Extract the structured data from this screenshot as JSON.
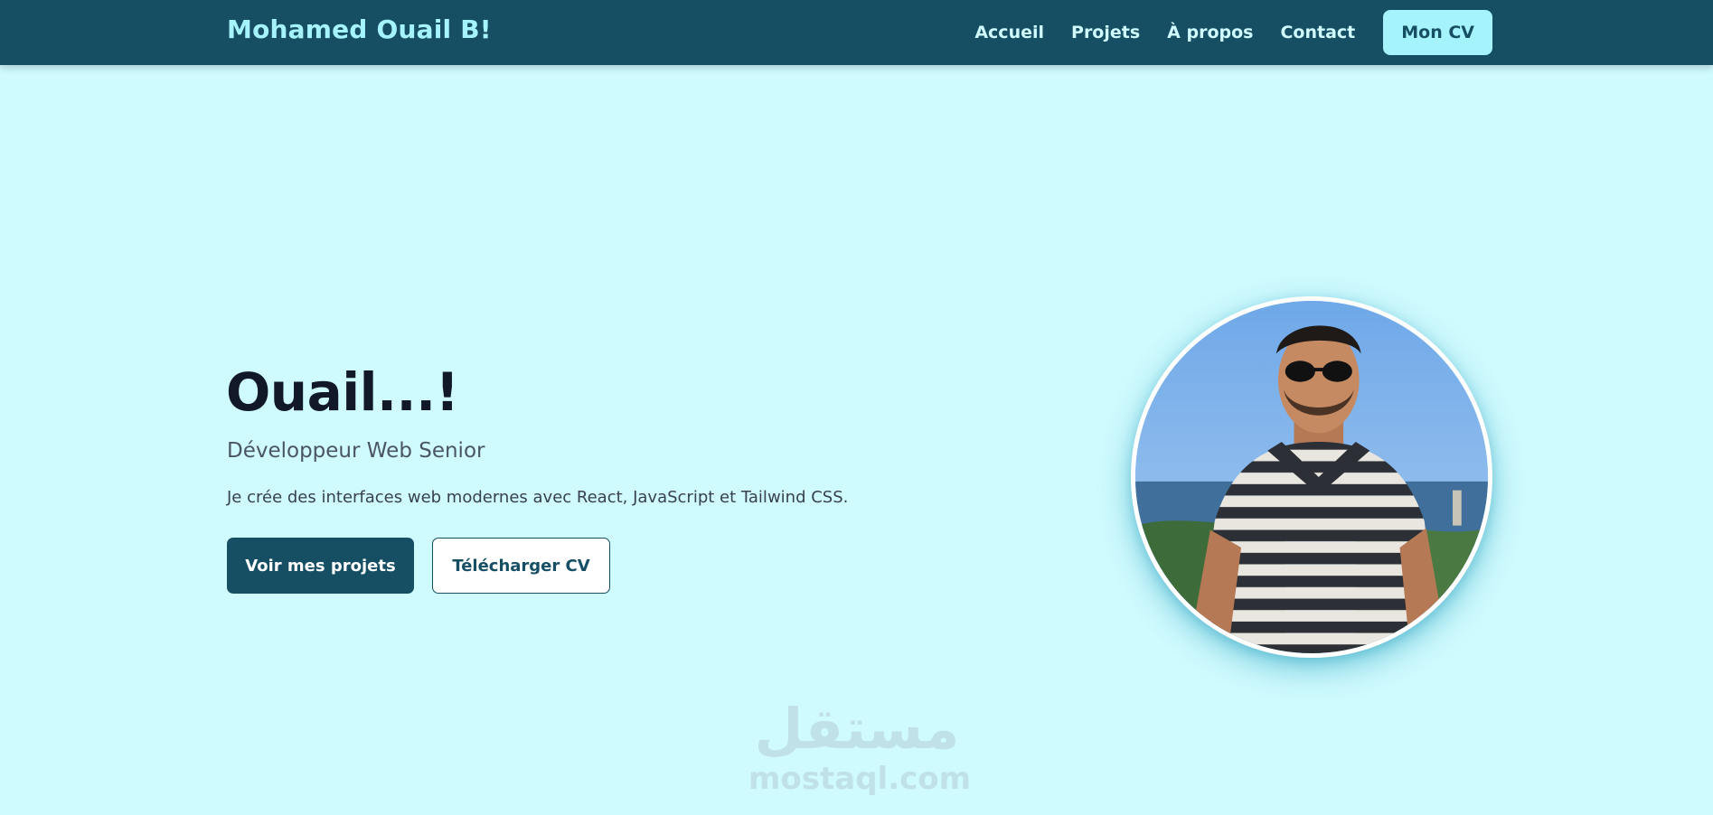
{
  "navbar": {
    "brand": "Mohamed Ouail B!",
    "links": [
      "Accueil",
      "Projets",
      "À propos",
      "Contact"
    ],
    "cv_button": "Mon CV"
  },
  "hero": {
    "title": "Ouail...!",
    "subtitle": "Développeur Web Senior",
    "description": "Je crée des interfaces web modernes avec React, JavaScript et Tailwind CSS.",
    "primary_button": "Voir mes projets",
    "secondary_button": "Télécharger CV"
  },
  "watermark": {
    "arabic": "مستقل",
    "latin": "mostaql.com"
  },
  "colors": {
    "navbar_bg": "#164e63",
    "page_bg": "#cffafe",
    "brand": "#a5f3fc",
    "cv_button_bg": "#a5f3fc",
    "primary_button_bg": "#164e63"
  },
  "icons": {
    "profile_photo": "profile-photo-man-striped-polo-sunglasses"
  }
}
